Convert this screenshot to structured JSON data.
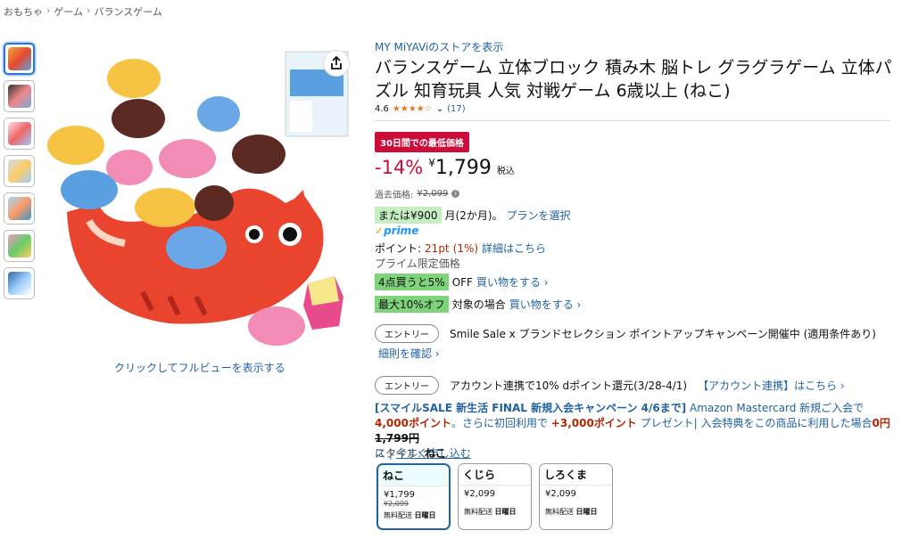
{
  "breadcrumb": [
    "おもちゃ",
    "ゲーム",
    "バランスゲーム"
  ],
  "breadcrumb_sep": "›",
  "full_view_link": "クリックしてフルビューを表示する",
  "store_link": "MY MiYAViのストアを表示",
  "title": "バランスゲーム 立体ブロック 積み木 脳トレ グラグラゲーム 立体パズル 知育玩具 人気 対戦ゲーム 6歳以上 (ねこ)",
  "rating": {
    "value": "4.6",
    "stars": "★★★★☆",
    "count": "(17)"
  },
  "deal_badge": "30日間での最低価格",
  "price": {
    "discount": "-14%",
    "currency": "¥",
    "amount": "1,799",
    "tax": "税込"
  },
  "past_price": {
    "label": "過去価格:",
    "value": "¥2,099"
  },
  "installment": {
    "badge": "または¥900",
    "text": "月(2か月)。",
    "link": "プランを選択"
  },
  "prime": {
    "check": "✓",
    "label": "prime"
  },
  "points": {
    "label": "ポイント:",
    "value": "21pt",
    "pct": "(1%)",
    "link": "詳細はこちら"
  },
  "prime_only": "プライム限定価格",
  "bulk": {
    "badge": "4点買うと5%",
    "text": "OFF",
    "link": "買い物をする ›"
  },
  "max_off": {
    "badge": "最大10%オフ",
    "text": "対象の場合",
    "link": "買い物をする ›"
  },
  "entry1": {
    "pill": "エントリー",
    "text": "Smile Sale x ブランドセレクション ポイントアップキャンペーン開催中 (適用条件あり)",
    "link": "細則を確認 ›"
  },
  "entry2": {
    "pill": "エントリー",
    "text": "アカウント連携で10% dポイント還元(3/28-4/1)",
    "link": "【アカウント連携】はこちら ›"
  },
  "promo": {
    "headline": "[スマイルSALE 新生活 FINAL 新規入会キャンペーン 4/6まで]",
    "part1": " Amazon Mastercard 新規ご入会で ",
    "points": "4,000ポイント",
    "part2": "。さらに初回利用で ",
    "extra": "+3,000ポイント",
    "part3": " プレゼント| 入会特典をこの商品に利用した場合",
    "zero": "0円",
    "orig": "1,799円",
    "part4": "に | ",
    "apply": "今すぐ申し込む"
  },
  "style": {
    "label": "スタイル:",
    "value": "ねこ"
  },
  "variants": [
    {
      "name": "ねこ",
      "price": "¥1,799",
      "old": "¥2,099",
      "ship": "無料配送",
      "day": "日曜日"
    },
    {
      "name": "くじら",
      "price": "¥2,099",
      "old": "",
      "ship": "無料配送",
      "day": "日曜日"
    },
    {
      "name": "しろくま",
      "price": "¥2,099",
      "old": "",
      "ship": "無料配送",
      "day": "日曜日"
    }
  ],
  "colors": {
    "link": "#2162a1",
    "deal_red": "#cc0c39",
    "star": "#de7921",
    "prime_blue": "#1a98ff",
    "green_badge": "#7fd37a"
  }
}
